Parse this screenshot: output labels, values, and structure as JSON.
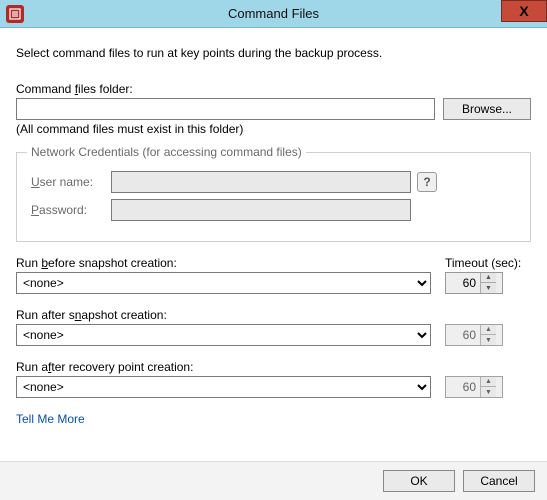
{
  "window": {
    "title": "Command Files",
    "close_glyph": "X"
  },
  "intro": "Select command files to run at key points during the backup process.",
  "folder": {
    "label_pre": "Command ",
    "label_u": "f",
    "label_post": "iles folder:",
    "value": "",
    "browse": "Browse...",
    "hint": "(All command files must exist in this folder)"
  },
  "creds": {
    "legend": "Network Credentials (for accessing command files)",
    "user_u": "U",
    "user_post": "ser name:",
    "user_value": "",
    "pass_u": "P",
    "pass_post": "assword:",
    "pass_value": "",
    "help_glyph": "?"
  },
  "runs": {
    "before": {
      "label_pre": "Run ",
      "label_u": "b",
      "label_post": "efore snapshot creation:",
      "value": "<none>"
    },
    "after_snapshot": {
      "label_pre": "Run after s",
      "label_u": "n",
      "label_post": "apshot creation:",
      "value": "<none>"
    },
    "after_recovery": {
      "label_pre": "Run a",
      "label_u": "f",
      "label_post": "ter recovery point creation:",
      "value": "<none>"
    },
    "timeout_label": "Timeout (sec):",
    "timeout1": "60",
    "timeout2": "60",
    "timeout3": "60"
  },
  "link": "Tell Me More",
  "footer": {
    "ok": "OK",
    "cancel": "Cancel"
  }
}
